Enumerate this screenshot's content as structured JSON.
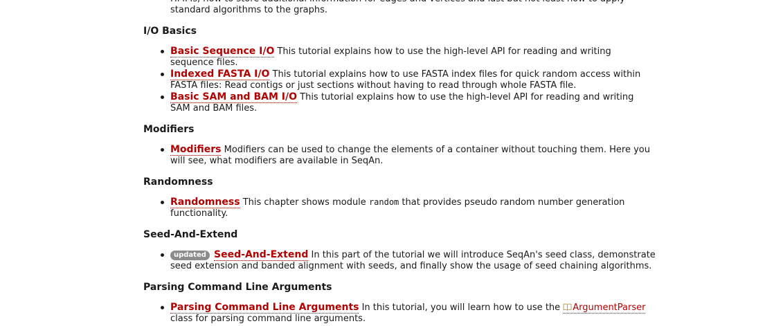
{
  "intro_text": "HMMs, how to store additional information for edges and vertices and last but not least how to apply standard algorithms to the graphs.",
  "sections": [
    {
      "heading": "I/O Basics",
      "items": [
        {
          "link": "Basic Sequence I/O",
          "desc": " This tutorial explains how to use the high-level API for reading and writing sequence files."
        },
        {
          "link": "Indexed FASTA I/O",
          "desc": " This tutorial explains how to use FASTA index files for quick random access within FASTA files: Read contigs or just sections without having to read through whole FASTA file."
        },
        {
          "link": "Basic SAM and BAM I/O",
          "desc": " This tutorial explains how to use the high-level API for reading and writing SAM and BAM files."
        }
      ]
    },
    {
      "heading": "Modifiers",
      "items": [
        {
          "link": "Modifiers",
          "desc": " Modifiers can be used to change the elements of a container without touching them. Here you will see, what modifiers are available in SeqAn."
        }
      ]
    },
    {
      "heading": "Randomness",
      "items": [
        {
          "link": "Randomness",
          "desc_before": " This chapter shows module ",
          "code": "random",
          "desc_after": " that provides pseudo random number generation functionality."
        }
      ]
    },
    {
      "heading": "Seed-And-Extend",
      "items": [
        {
          "badge": "updated",
          "link": "Seed-And-Extend",
          "desc": " In this part of the tutorial we will introduce SeqAn's seed class, demonstrate seed extension and banded alignment with seeds, and finally show the usage of seed chaining algorithms."
        }
      ]
    },
    {
      "heading": "Parsing Command Line Arguments",
      "items": [
        {
          "link": "Parsing Command Line Arguments",
          "desc_before": " In this tutorial, you will learn how to use the ",
          "ref": "ArgumentParser",
          "desc_after": " class for parsing command line arguments."
        }
      ]
    }
  ],
  "colors": {
    "link": "#b30000",
    "badge_bg": "#8c8c8c",
    "text": "#1a1a1a"
  },
  "icons": {
    "ref_icon": "book-icon"
  }
}
